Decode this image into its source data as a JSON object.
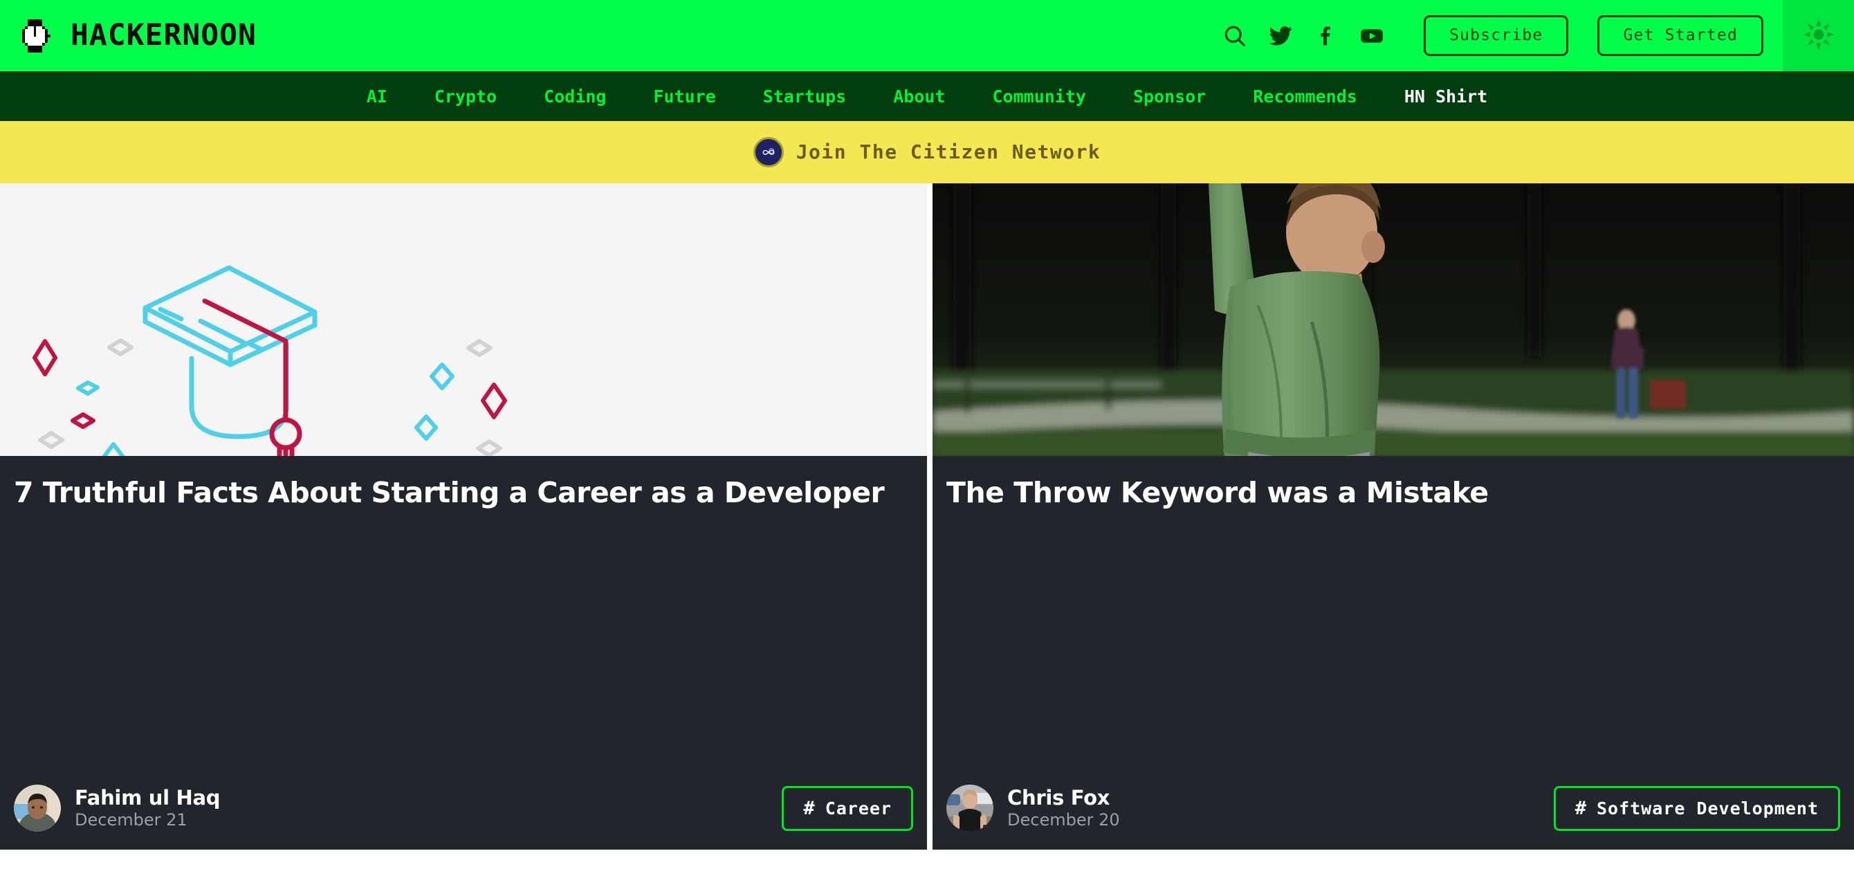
{
  "header": {
    "brand_name": "HACKERNOON",
    "logo_icon": "pixel-watch-icon",
    "icons": [
      {
        "name": "search-icon",
        "label": "Search"
      },
      {
        "name": "twitter-icon",
        "label": "Twitter"
      },
      {
        "name": "facebook-icon",
        "label": "Facebook"
      },
      {
        "name": "youtube-icon",
        "label": "YouTube"
      }
    ],
    "subscribe_label": "Subscribe",
    "get_started_label": "Get Started",
    "theme_toggle_icon": "sun-icon",
    "bg_color": "#00FF48",
    "text_color": "#013D0D",
    "toggle_bg_color": "#00E53F"
  },
  "nav": {
    "bg_color": "#013D0D",
    "link_color": "#00F13C",
    "highlight_color": "#FFFFFF",
    "items": [
      {
        "label": "AI",
        "highlighted": false
      },
      {
        "label": "Crypto",
        "highlighted": false
      },
      {
        "label": "Coding",
        "highlighted": false
      },
      {
        "label": "Future",
        "highlighted": false
      },
      {
        "label": "Startups",
        "highlighted": false
      },
      {
        "label": "About",
        "highlighted": false
      },
      {
        "label": "Community",
        "highlighted": false
      },
      {
        "label": "Sponsor",
        "highlighted": false
      },
      {
        "label": "Recommends",
        "highlighted": false
      },
      {
        "label": "HN Shirt",
        "highlighted": true
      }
    ]
  },
  "banner": {
    "text": "Join The Citizen Network",
    "badge_icon": "citizen-network-logo-icon",
    "bg_color": "#F5E752",
    "text_color": "#6B5D1F"
  },
  "cards": [
    {
      "media_type": "illustration",
      "media_name": "graduation-cap-diploma-illustration",
      "title": "7 Truthful Facts About Starting a Career as a Developer",
      "author": "Fahim ul Haq",
      "date": "December 21",
      "avatar_name": "author-avatar-fahim-ul-haq",
      "tag": "Career",
      "tag_symbol": "#",
      "tag_border_color": "#00E526"
    },
    {
      "media_type": "photo",
      "media_name": "boy-throwing-ball-photo",
      "title": "The Throw Keyword was a Mistake",
      "author": "Chris Fox",
      "date": "December 20",
      "avatar_name": "author-avatar-chris-fox",
      "tag": "Software Development",
      "tag_symbol": "#",
      "tag_border_color": "#00E526"
    }
  ],
  "palette": {
    "card_bg": "#22262C",
    "illustration_bg": "#F5F5F6",
    "illustration_cyan": "#4FD0E8",
    "illustration_crimson": "#BE1542",
    "illustration_gray": "#D6D1D1"
  }
}
